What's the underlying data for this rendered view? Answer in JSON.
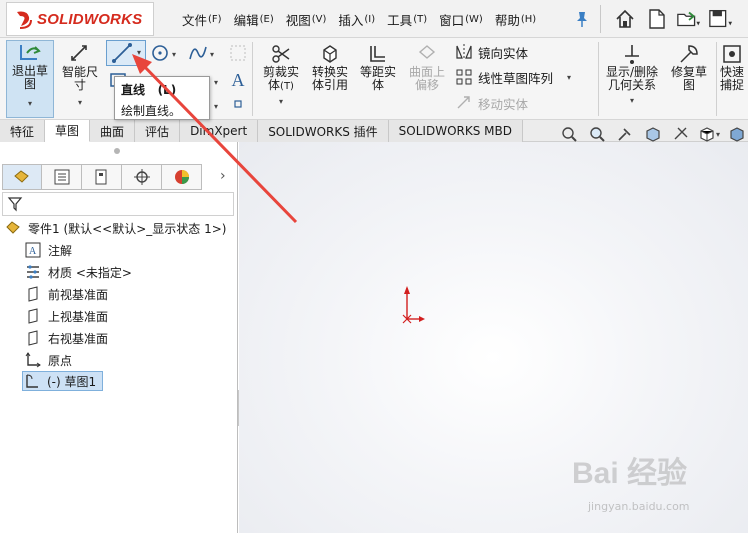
{
  "app": {
    "logo_text": "SOLIDWORKS",
    "brand_color": "#d52b1e"
  },
  "menu": [
    {
      "label": "文件",
      "key": "(F)"
    },
    {
      "label": "编辑",
      "key": "(E)"
    },
    {
      "label": "视图",
      "key": "(V)"
    },
    {
      "label": "插入",
      "key": "(I)"
    },
    {
      "label": "工具",
      "key": "(T)"
    },
    {
      "label": "窗口",
      "key": "(W)"
    },
    {
      "label": "帮助",
      "key": "(H)"
    }
  ],
  "ribbon": {
    "exit_sketch": "退出草图",
    "smart_dimension": "智能尺寸",
    "trim_entities": "剪裁实体",
    "trim_entities_key": "(T)",
    "convert_entities": "转换实体引用",
    "offset_entities": "等距实体",
    "surface_offset": "曲面上偏移",
    "mirror_entities": "镜向实体",
    "linear_pattern": "线性草图阵列",
    "move_entities": "移动实体",
    "display_delete_relations": "显示/删除几何关系",
    "repair_sketch": "修复草图",
    "quick_snaps": "快速捕捉"
  },
  "tooltip": {
    "title": "直线",
    "shortcut": "(L)",
    "description": "绘制直线。"
  },
  "tabs": [
    {
      "label": "特征",
      "active": false
    },
    {
      "label": "草图",
      "active": true
    },
    {
      "label": "曲面",
      "active": false
    },
    {
      "label": "评估",
      "active": false
    },
    {
      "label": "DimXpert",
      "active": false
    },
    {
      "label": "SOLIDWORKS 插件",
      "active": false
    },
    {
      "label": "SOLIDWORKS MBD",
      "active": false
    }
  ],
  "tree": {
    "root": "零件1  (默认<<默认>_显示状态 1>)",
    "items": [
      {
        "label": "注解",
        "icon": "annotation-icon"
      },
      {
        "label": "材质 <未指定>",
        "icon": "material-icon"
      },
      {
        "label": "前视基准面",
        "icon": "plane-icon"
      },
      {
        "label": "上视基准面",
        "icon": "plane-icon"
      },
      {
        "label": "右视基准面",
        "icon": "plane-icon"
      },
      {
        "label": "原点",
        "icon": "origin-icon"
      },
      {
        "label": "(-) 草图1",
        "icon": "sketch-icon"
      }
    ]
  },
  "watermark": {
    "text": "Bai 经验",
    "sub": "jingyan.baidu.com"
  },
  "colors": {
    "accent": "#4a8fd4",
    "selection": "#cde1f5",
    "arrow": "#e8453c",
    "origin": "#d21f1f"
  }
}
